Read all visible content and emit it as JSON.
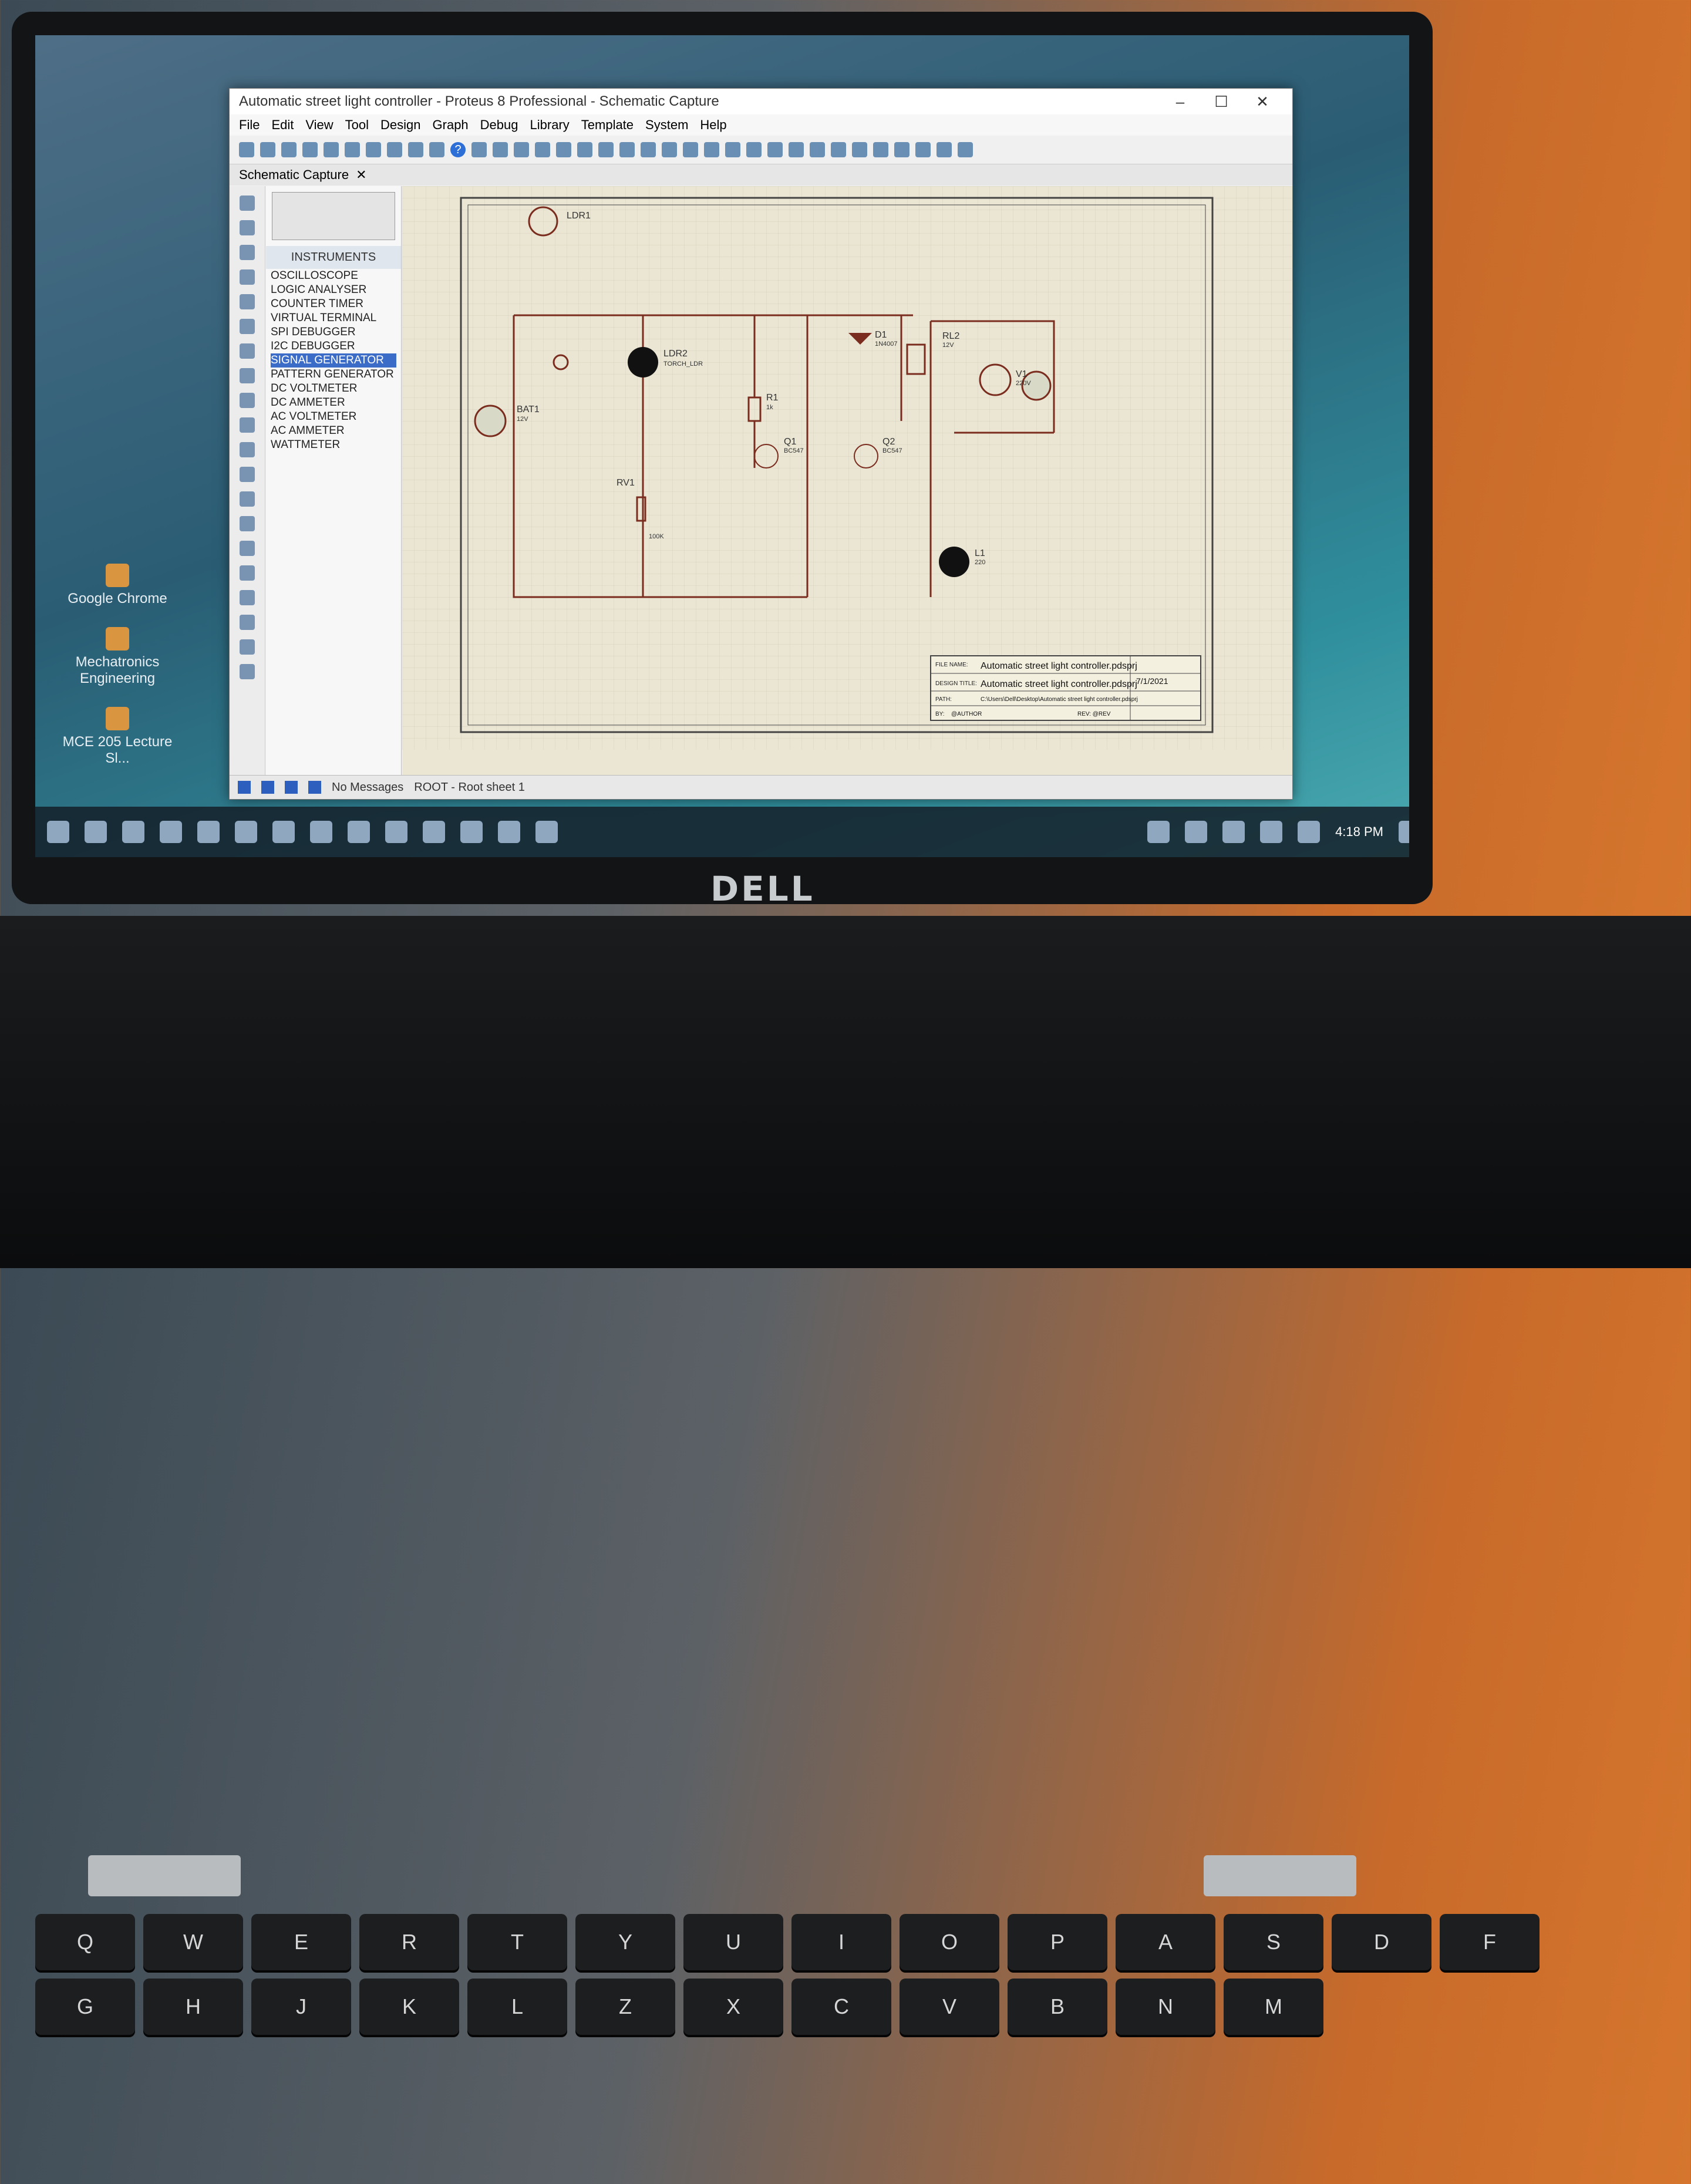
{
  "window": {
    "title": "Automatic street light controller - Proteus 8 Professional - Schematic Capture",
    "controls": [
      "–",
      "☐",
      "✕"
    ]
  },
  "menu": [
    "File",
    "Edit",
    "View",
    "Tool",
    "Design",
    "Graph",
    "Debug",
    "Library",
    "Template",
    "System",
    "Help"
  ],
  "tab": {
    "label": "Schematic Capture",
    "close": "✕"
  },
  "picker": {
    "header": "INSTRUMENTS",
    "items": [
      "OSCILLOSCOPE",
      "LOGIC ANALYSER",
      "COUNTER TIMER",
      "VIRTUAL TERMINAL",
      "SPI DEBUGGER",
      "I2C DEBUGGER",
      "SIGNAL GENERATOR",
      "PATTERN GENERATOR",
      "DC VOLTMETER",
      "DC AMMETER",
      "AC VOLTMETER",
      "AC AMMETER",
      "WATTMETER"
    ],
    "selected": "SIGNAL GENERATOR"
  },
  "schematic": {
    "labels": {
      "ldr1": "LDR1",
      "ldr2": "LDR2",
      "ldr2_sub": "TORCH_LDR",
      "r1": "R1",
      "r1_val": "1k",
      "d1": "D1",
      "d1_val": "1N4007",
      "rl2": "RL2",
      "rl2_val": "12V",
      "bat1": "BAT1",
      "bat1_val": "12V",
      "rv1": "RV1",
      "rv1_val": "100K",
      "q1": "Q1",
      "q1_val": "BC547",
      "q2": "Q2",
      "q2_val": "BC547",
      "v1": "V1",
      "v1_val": "220V",
      "l1": "L1",
      "l1_val": "220"
    },
    "titleblock": {
      "file_name_label": "FILE NAME:",
      "file_name": "Automatic street light controller.pdsprj",
      "date": "7/1/2021",
      "design_title_label": "DESIGN TITLE:",
      "design_title": "Automatic street light controller.pdsprj",
      "path_label": "PATH:",
      "path": "C:\\Users\\Dell\\Desktop\\Automatic street light controller.pdsprj",
      "by_label": "BY:",
      "by": "@AUTHOR",
      "rev": "REV: @REV"
    }
  },
  "status": {
    "messages": "No Messages",
    "sheet": "ROOT - Root sheet 1"
  },
  "desktop_icons": [
    "Google Chrome",
    "Mechatronics Engineering",
    "MCE 205 Lecture Sl..."
  ],
  "taskbar": {
    "time": "4:18 PM"
  },
  "laptop": {
    "brand": "DELL"
  },
  "keys": [
    "Q",
    "W",
    "E",
    "R",
    "T",
    "Y",
    "U",
    "I",
    "O",
    "P",
    "A",
    "S",
    "D",
    "F",
    "G",
    "H",
    "J",
    "K",
    "L",
    "Z",
    "X",
    "C",
    "V",
    "B",
    "N",
    "M"
  ]
}
